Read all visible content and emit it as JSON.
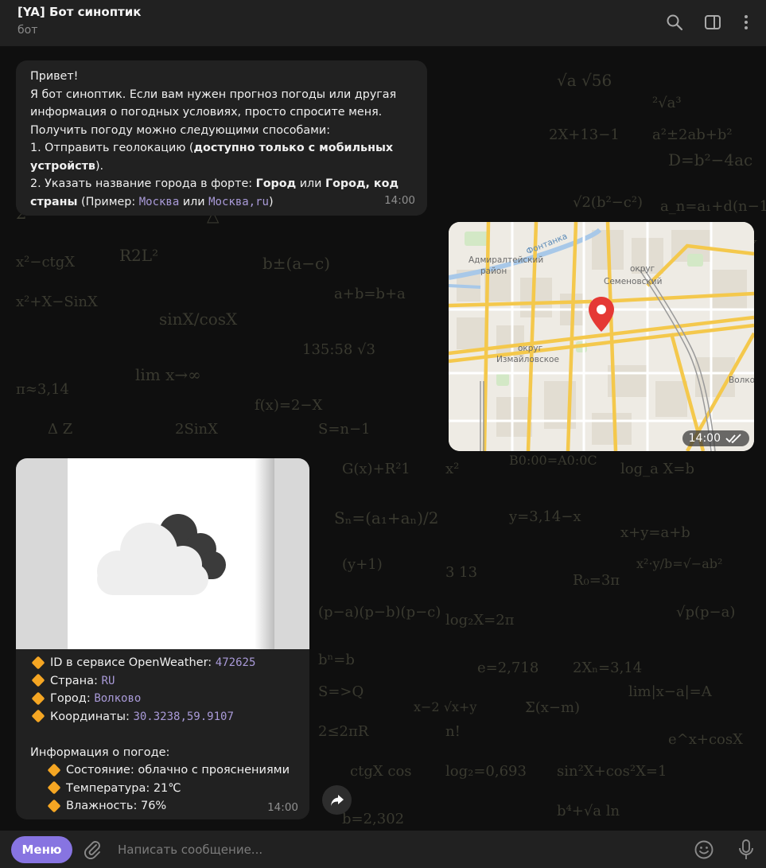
{
  "header": {
    "title": "[YA] Бот синоптик",
    "subtitle": "бот"
  },
  "messages": {
    "welcome": {
      "lines": [
        "Привет!",
        "Я бот синоптик. Если вам нужен прогноз погоды или другая",
        "информация о погодных условиях, просто спросите меня.",
        "Получить погоду можно следующими способами:"
      ],
      "item1_prefix": "1. Отправить геолокацию (",
      "item1_bold_a": "доступно только с мобильных",
      "item1_bold_b": "устройств",
      "item1_suffix": ").",
      "item2_prefix": "2. Указать название города в форте: ",
      "item2_bold_a": "Город",
      "item2_or": " или ",
      "item2_bold_b": "Город, код",
      "item2_bold_c": "страны",
      "item2_example": " (Пример: ",
      "example1": "Москва",
      "example_or": " или ",
      "example2": "Москва,ru",
      "example_close": ")",
      "time": "14:00"
    },
    "location": {
      "labels": [
        "Адмиралтейский",
        "район",
        "округ",
        "Семеновский",
        "округ",
        "Измайловское",
        "Фонтанка",
        "Волков"
      ],
      "time": "14:00"
    },
    "weather": {
      "id_label": "ID в сервисе OpenWeather: ",
      "id_value": "472625",
      "country_label": "Страна: ",
      "country_value": "RU",
      "city_label": "Город: ",
      "city_value": "Волково",
      "coords_label": "Координаты: ",
      "coords_value": "30.3238,59.9107",
      "info_title": "Информация о погоде:",
      "state_label": "Состояние: облачно с прояснениями",
      "temp_label": "Температура: 21℃",
      "humidity_label": "Влажность: 76%",
      "time": "14:00"
    }
  },
  "input": {
    "menu_label": "Меню",
    "placeholder": "Написать сообщение..."
  },
  "colors": {
    "accent": "#8774e1",
    "link": "#a99ad8",
    "bubble": "#212121",
    "diamond": "#f5a623"
  },
  "icons": [
    "search-icon",
    "sidebar-icon",
    "more-icon",
    "attach-icon",
    "emoji-icon",
    "mic-icon",
    "share-icon",
    "map-pin-icon",
    "double-check-icon"
  ]
}
